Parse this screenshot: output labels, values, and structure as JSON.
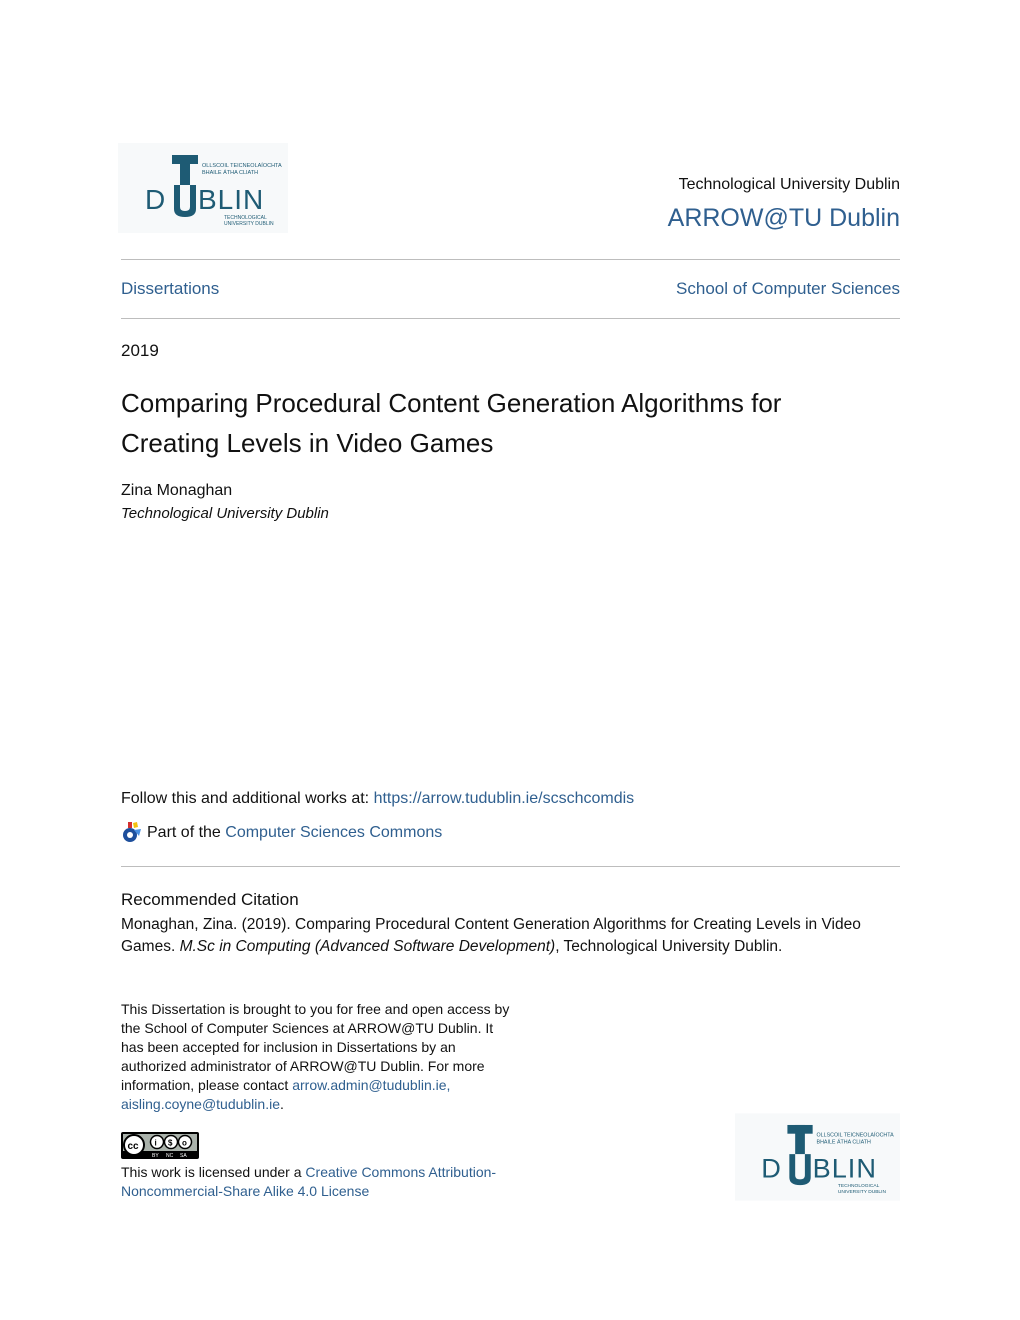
{
  "header": {
    "logo_top": {
      "irish_line1": "OLLSCOIL TEICNEOLAÍOCHTA",
      "irish_line2": "BHAILE ÁTHA CLIATH",
      "wordmark": "DUBLIN",
      "english_line1": "TECHNOLOGICAL",
      "english_line2": "UNIVERSITY DUBLIN"
    },
    "institution": "Technological University Dublin",
    "repository": "ARROW@TU Dublin"
  },
  "nav": {
    "collection": "Dissertations",
    "school": "School of Computer Sciences"
  },
  "document": {
    "year": "2019",
    "title": "Comparing Procedural Content Generation Algorithms for Creating Levels in Video Games",
    "author": "Zina Monaghan",
    "affiliation": "Technological University Dublin"
  },
  "links": {
    "follow_prefix": "Follow this and additional works at: ",
    "follow_url": "https://arrow.tudublin.ie/scschcomdis",
    "partof_prefix": "Part of the ",
    "partof_link": "Computer Sciences Commons",
    "commons_icon": "bepress-commons-icon"
  },
  "citation": {
    "heading": "Recommended Citation",
    "text_before": "Monaghan, Zina. (2019). Comparing Procedural Content Generation Algorithms for Creating Levels in Video Games. ",
    "text_italic": "M.Sc in Computing (Advanced Software Development)",
    "text_after": ", Technological University Dublin."
  },
  "notice": {
    "text": "This Dissertation is brought to you for free and open access by the School of Computer Sciences at ARROW@TU Dublin. It has been accepted for inclusion in Dissertations by an authorized administrator of ARROW@TU Dublin. For more information, please contact ",
    "email1": "arrow.admin@tudublin.ie,",
    "email2": "aisling.coyne@tudublin.ie",
    "end": "."
  },
  "license": {
    "badge_icon": "cc-by-nc-sa-icon",
    "badge_labels": [
      "BY",
      "NC",
      "SA"
    ],
    "prefix": "This work is licensed under a ",
    "link": "Creative Commons Attribution-Noncommercial-Share Alike 4.0 License"
  },
  "footer_logo": {
    "irish_line1": "OLLSCOIL TEICNEOLAÍOCHTA",
    "irish_line2": "BHAILE ÁTHA CLIATH",
    "wordmark": "DUBLIN",
    "english_line1": "TECHNOLOGICAL",
    "english_line2": "UNIVERSITY DUBLIN"
  },
  "colors": {
    "link": "#2f5f8f",
    "logo": "#1e5b74",
    "rule": "#bdbdbd"
  }
}
